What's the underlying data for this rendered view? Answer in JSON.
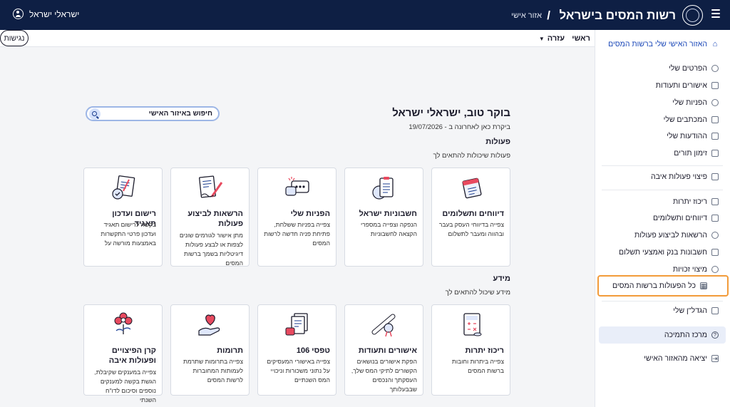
{
  "header": {
    "brand": "רשות המסים בישראל",
    "slash": "/",
    "area": "אזור אישי",
    "user_name": "ישראלי ישראל"
  },
  "nav": {
    "home": "ראשי",
    "help": "עזרה",
    "accessibility": "נגישות"
  },
  "sidebar": {
    "home": "האזור האישי שלי ברשות המסים",
    "items": [
      {
        "label": "הפרטים שלי",
        "icon": "user-icon"
      },
      {
        "label": "אישורים ותעודות",
        "icon": "document-icon"
      },
      {
        "label": "הפניות שלי",
        "icon": "chat-icon"
      },
      {
        "label": "המכתבים שלי",
        "icon": "mail-icon"
      },
      {
        "label": "ההודעות שלי",
        "icon": "message-icon"
      },
      {
        "label": "זימון תורים",
        "icon": "calendar-icon"
      }
    ],
    "compensation": "פיצוי פעולות איבה",
    "items2": [
      {
        "label": "ריכוז יתרות",
        "icon": "database-icon"
      },
      {
        "label": "דיווחים ותשלומים",
        "icon": "folder-icon"
      },
      {
        "label": "הרשאות לביצוע פעולות",
        "icon": "users-icon"
      },
      {
        "label": "חשבונות בנק ואמצעי תשלום",
        "icon": "card-icon"
      },
      {
        "label": "מיצוי זכויות",
        "icon": "heart-icon"
      }
    ],
    "all_actions": "כל הפעולות ברשות המסים",
    "my_growth": "הגדל\"ן שלי",
    "support": "מרכז התמיכה",
    "logout": "יציאה מהאזור האישי"
  },
  "main": {
    "greeting": "בוקר טוב, ישראלי ישראל",
    "last_visit_label": "ביקרת כאן לאחרונה ב -",
    "last_visit_date": "19/07/2026",
    "search_placeholder": "חיפוש באיזור האישי",
    "actions_title": "פעולות",
    "actions_sub": "פעולות שיכולות להתאים לך",
    "info_title": "מידע",
    "info_sub": "מידע שיכול להתאים לך",
    "action_cards": [
      {
        "title": "דיווחים ותשלומים",
        "desc": "צפייה בדיווחי העסק בעבר ובהווה ומעבר לתשלום",
        "icon": "calendar-report-icon"
      },
      {
        "title": "חשבוניות ישראל",
        "desc": "הנפקה וצפייה במספרי הקצאה לחשבוניות",
        "icon": "invoice-icon"
      },
      {
        "title": "הפניות שלי",
        "desc": "צפייה בפניות ששלחת, פתיחת פניה חדשה לרשות המסים",
        "icon": "chat-bubbles-icon"
      },
      {
        "title": "הרשאות לביצוע פעולות",
        "desc": "מתן אישור לגורמים שונים לצפות או לבצע פעולות דיגיטליות בשמך ברשות המסים",
        "icon": "signing-pen-icon"
      },
      {
        "title": "רישום ועדכון תאגיד",
        "desc": "בקשה לרישום תאגיד ועדכון פרטי התקשרות באמצעות מורשה על",
        "icon": "signature-check-icon"
      }
    ],
    "info_cards": [
      {
        "title": "ריכוז יתרות",
        "desc": "צפייה ביתרות וחובות ברשות המסים",
        "icon": "calculator-icon"
      },
      {
        "title": "אישורים ותעודות",
        "desc": "הפקת אישורים בנושאים הקשורים לתיקי המס שלך, העסקתך והנכסים שבבעלותך",
        "icon": "diploma-icon"
      },
      {
        "title": "טפסי 106",
        "desc": "צפייה באישורי המעסיקים על נתוני משכורות וניכויי המס השנתיים",
        "icon": "forms-icon"
      },
      {
        "title": "תרומות",
        "desc": "צפייה בתרומות שתרמת לעמותות המחוברות לרשות המסים",
        "icon": "donation-heart-icon"
      },
      {
        "title": "קרן הפיצויים ופעולות איבה",
        "desc": "צפייה במענקים שקיבלת, הגשת בקשה למענקים נוספים וסיכום לדו\"ח השנתי",
        "icon": "flower-icon"
      }
    ]
  },
  "colors": {
    "header_bg": "#0e1f44",
    "accent": "#1a47b8",
    "highlight": "#f29b3a",
    "support_bg": "#e9eef9"
  }
}
